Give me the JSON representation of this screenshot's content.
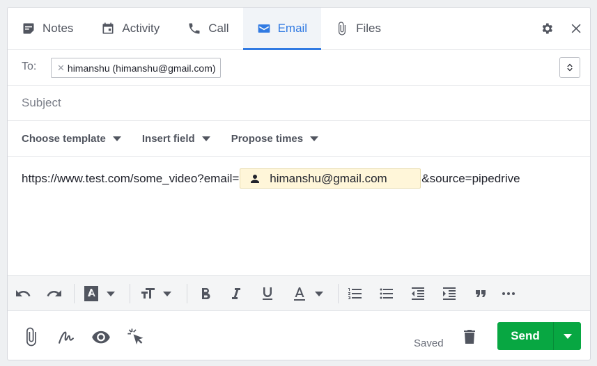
{
  "tabs": [
    {
      "label": "Notes",
      "icon": "notes-icon"
    },
    {
      "label": "Activity",
      "icon": "calendar-icon"
    },
    {
      "label": "Call",
      "icon": "phone-icon"
    },
    {
      "label": "Email",
      "icon": "envelope-icon",
      "active": true
    },
    {
      "label": "Files",
      "icon": "paperclip-icon"
    }
  ],
  "to": {
    "label": "To:",
    "recipients": [
      {
        "display": "himanshu (himanshu@gmail.com)"
      }
    ]
  },
  "subject": {
    "placeholder": "Subject",
    "value": ""
  },
  "template_bar": {
    "choose_template": "Choose template",
    "insert_field": "Insert field",
    "propose_times": "Propose times"
  },
  "body": {
    "prefix": "https://www.test.com/some_video?email=",
    "field_value": "himanshu@gmail.com",
    "suffix": "&source=pipedrive"
  },
  "format_toolbar": [
    "undo-icon",
    "redo-icon",
    "highlight-color-icon",
    "font-size-icon",
    "bold-icon",
    "italic-icon",
    "underline-icon",
    "text-color-icon",
    "numbered-list-icon",
    "bulleted-list-icon",
    "outdent-icon",
    "indent-icon",
    "quote-icon",
    "more-icon"
  ],
  "bottom": {
    "saved_label": "Saved",
    "send_label": "Send"
  },
  "colors": {
    "accent": "#317ae2",
    "send": "#08a742",
    "field_highlight": "#fff6d9"
  }
}
